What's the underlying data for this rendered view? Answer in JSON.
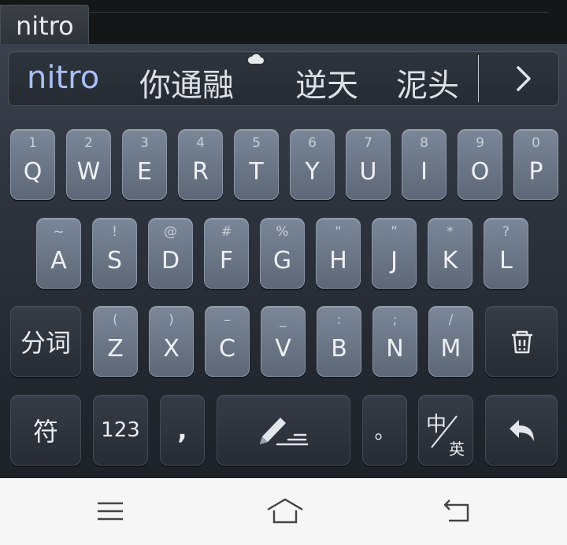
{
  "composing": {
    "text": "nitro"
  },
  "candidates": [
    {
      "text": "nitro",
      "active": true
    },
    {
      "text": "你通融",
      "cloud": true
    },
    {
      "text": "逆天"
    },
    {
      "text": "泥头"
    }
  ],
  "row1": [
    {
      "sub": "1",
      "main": "Q"
    },
    {
      "sub": "2",
      "main": "W"
    },
    {
      "sub": "3",
      "main": "E"
    },
    {
      "sub": "4",
      "main": "R"
    },
    {
      "sub": "5",
      "main": "T"
    },
    {
      "sub": "6",
      "main": "Y"
    },
    {
      "sub": "7",
      "main": "U"
    },
    {
      "sub": "8",
      "main": "I"
    },
    {
      "sub": "9",
      "main": "O"
    },
    {
      "sub": "0",
      "main": "P"
    }
  ],
  "row2": [
    {
      "sub": "~",
      "main": "A"
    },
    {
      "sub": "!",
      "main": "S"
    },
    {
      "sub": "@",
      "main": "D"
    },
    {
      "sub": "#",
      "main": "F"
    },
    {
      "sub": "%",
      "main": "G"
    },
    {
      "sub": "“",
      "main": "H"
    },
    {
      "sub": "”",
      "main": "J"
    },
    {
      "sub": "*",
      "main": "K"
    },
    {
      "sub": "?",
      "main": "L"
    }
  ],
  "row3": [
    {
      "sub": "(",
      "main": "Z"
    },
    {
      "sub": ")",
      "main": "X"
    },
    {
      "sub": "–",
      "main": "C"
    },
    {
      "sub": "_",
      "main": "V"
    },
    {
      "sub": ":",
      "main": "B"
    },
    {
      "sub": ";",
      "main": "N"
    },
    {
      "sub": "/",
      "main": "M"
    }
  ],
  "keys": {
    "segment": "分词",
    "symbols": "符",
    "numbers": "123",
    "comma": ",",
    "period": "。",
    "lang_zh": "中",
    "lang_en": "英"
  }
}
